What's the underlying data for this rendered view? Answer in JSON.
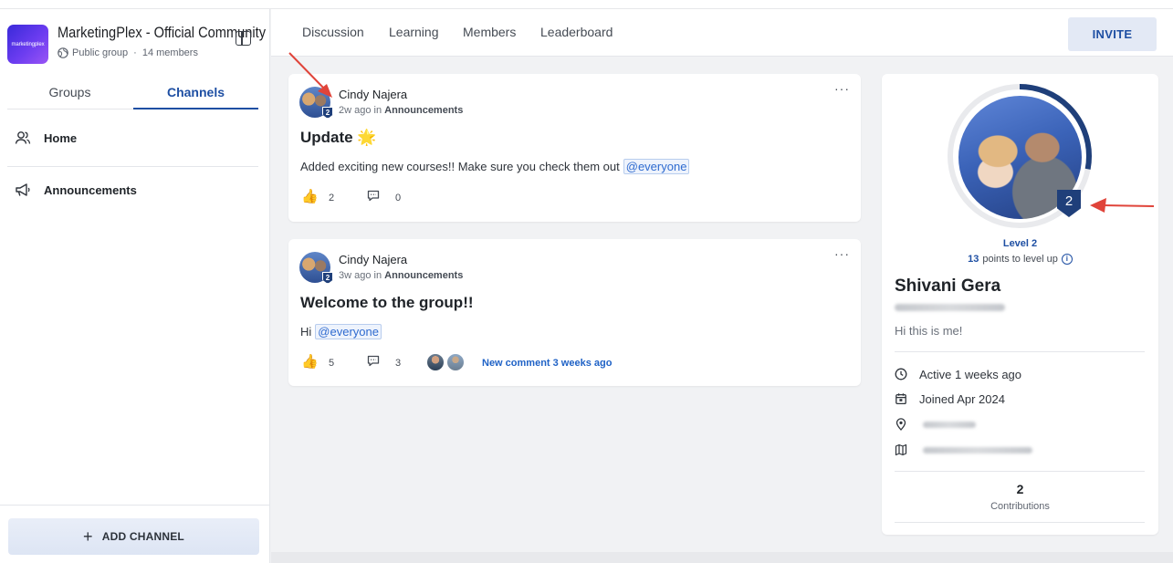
{
  "group": {
    "logo_text": "marketingplex",
    "name": "MarketingPlex - Official Community",
    "visibility": "Public group",
    "separator": "·",
    "members": "14 members"
  },
  "sidebar": {
    "tabs": [
      {
        "label": "Groups",
        "active": false
      },
      {
        "label": "Channels",
        "active": true
      }
    ],
    "channels": [
      {
        "label": "Home",
        "icon": "people-icon"
      },
      {
        "label": "Announcements",
        "icon": "megaphone-icon"
      }
    ],
    "add_channel_label": "ADD CHANNEL"
  },
  "nav": {
    "tabs": [
      "Discussion",
      "Learning",
      "Members",
      "Leaderboard"
    ],
    "invite_label": "INVITE"
  },
  "posts": [
    {
      "author": "Cindy Najera",
      "time": "2w ago in",
      "channel": "Announcements",
      "level_badge": "2",
      "title": "Update 🌟",
      "body": "Added exciting new courses!! Make sure you check them out",
      "mention": "@everyone",
      "likes": "2",
      "comments": "0"
    },
    {
      "author": "Cindy Najera",
      "time": "3w ago in",
      "channel": "Announcements",
      "level_badge": "2",
      "title": "Welcome to the group!!",
      "body": "Hi",
      "mention": "@everyone",
      "likes": "5",
      "comments": "3",
      "new_comment": "New comment 3 weeks ago"
    }
  ],
  "profile": {
    "level_badge": "2",
    "level_label": "Level 2",
    "points_to_level": "13",
    "points_suffix": "points to level up",
    "level_progress": 0.28,
    "name": "Shivani Gera",
    "bio": "Hi this is me!",
    "active": "Active 1 weeks ago",
    "joined": "Joined Apr 2024",
    "contributions_count": "2",
    "contributions_label": "Contributions"
  },
  "colors": {
    "accent": "#1e4fa3",
    "link": "#1f62c6",
    "annotation_arrow": "#e0443a"
  }
}
